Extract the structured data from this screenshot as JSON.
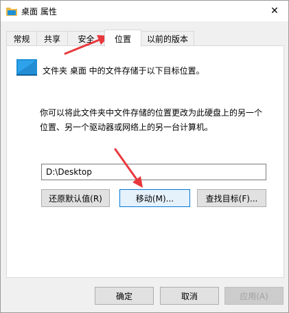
{
  "window": {
    "title": "桌面 属性",
    "close_glyph": "✕"
  },
  "tabs": [
    {
      "label": "常规"
    },
    {
      "label": "共享"
    },
    {
      "label": "安全"
    },
    {
      "label": "位置",
      "active": true
    },
    {
      "label": "以前的版本"
    }
  ],
  "location": {
    "description": "文件夹 桌面 中的文件存储于以下目标位置。",
    "info_line1": "你可以将此文件夹中文件存储的位置更改为此硬盘上的另一个",
    "info_line2": "位置、另一个驱动器或网络上的另一台计算机。",
    "path_value": "D:\\Desktop",
    "restore_default_label": "还原默认值(R)",
    "move_label": "移动(M)...",
    "find_target_label": "查找目标(F)..."
  },
  "footer": {
    "ok_label": "确定",
    "cancel_label": "取消",
    "apply_label": "应用(A)"
  },
  "colors": {
    "annotation_arrow": "#e8383d",
    "accent": "#0078d7"
  }
}
